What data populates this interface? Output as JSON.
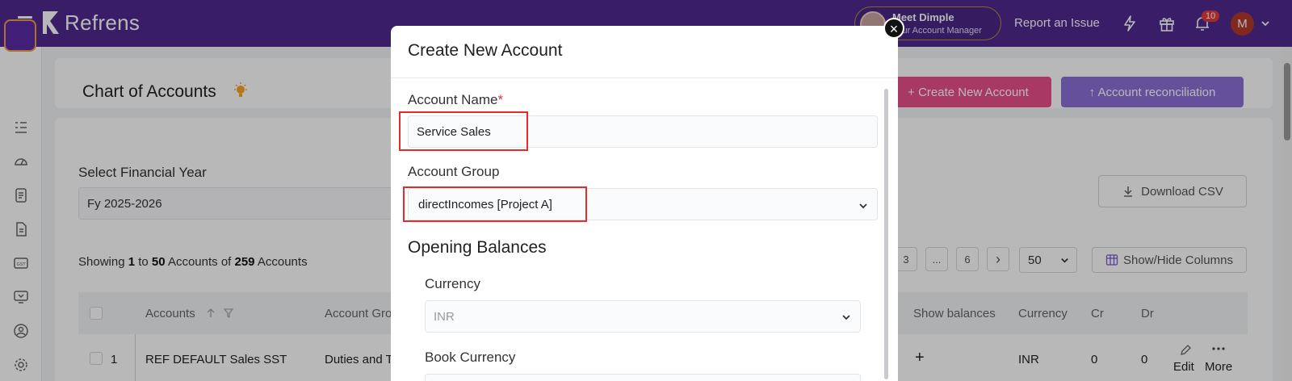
{
  "topbar": {
    "brand": "Refrens",
    "manager_name": "Meet Dimple",
    "manager_sub": "Your Account Manager",
    "report_issue": "Report an Issue",
    "notification_count": "10",
    "user_initial": "M"
  },
  "page": {
    "title": "Chart of Accounts",
    "create_button": "+ Create New Account",
    "reconcile_button": "↑ Account reconciliation",
    "fy_label": "Select Financial Year",
    "fy_value": "Fy 2025-2026",
    "download_csv": "Download CSV",
    "showing_prefix": "Showing ",
    "showing_from": "1",
    "showing_to_word": " to ",
    "showing_to": "50",
    "showing_of_word": " Accounts of ",
    "showing_total": "259",
    "showing_suffix": " Accounts",
    "pagination": [
      "3",
      "...",
      "6",
      "›"
    ],
    "per_page": "50",
    "show_hide_columns": "Show/Hide Columns"
  },
  "table": {
    "headers": {
      "accounts": "Accounts",
      "account_group": "Account Gro",
      "show_balances": "Show balances",
      "currency": "Currency",
      "cr": "Cr",
      "dr": "Dr"
    },
    "row1": {
      "index": "1",
      "account": "REF DEFAULT Sales SST",
      "group": "Duties and T",
      "show_balances": "+",
      "currency": "INR",
      "cr": "0",
      "dr": "0",
      "edit": "Edit",
      "more": "More"
    }
  },
  "modal": {
    "title": "Create New Account",
    "close": "×",
    "account_name_label": "Account Name",
    "required_mark": "*",
    "account_name_value": "Service Sales",
    "account_group_label": "Account Group",
    "account_group_value": "directIncomes [Project A]",
    "opening_balances": "Opening Balances",
    "currency_label": "Currency",
    "currency_value": "INR",
    "book_currency_label": "Book Currency"
  },
  "colors": {
    "topbar": "#4f2a8f",
    "create_button": "#e9508a",
    "reconcile_button": "#8c6fd8",
    "highlight": "#e52b2b"
  }
}
